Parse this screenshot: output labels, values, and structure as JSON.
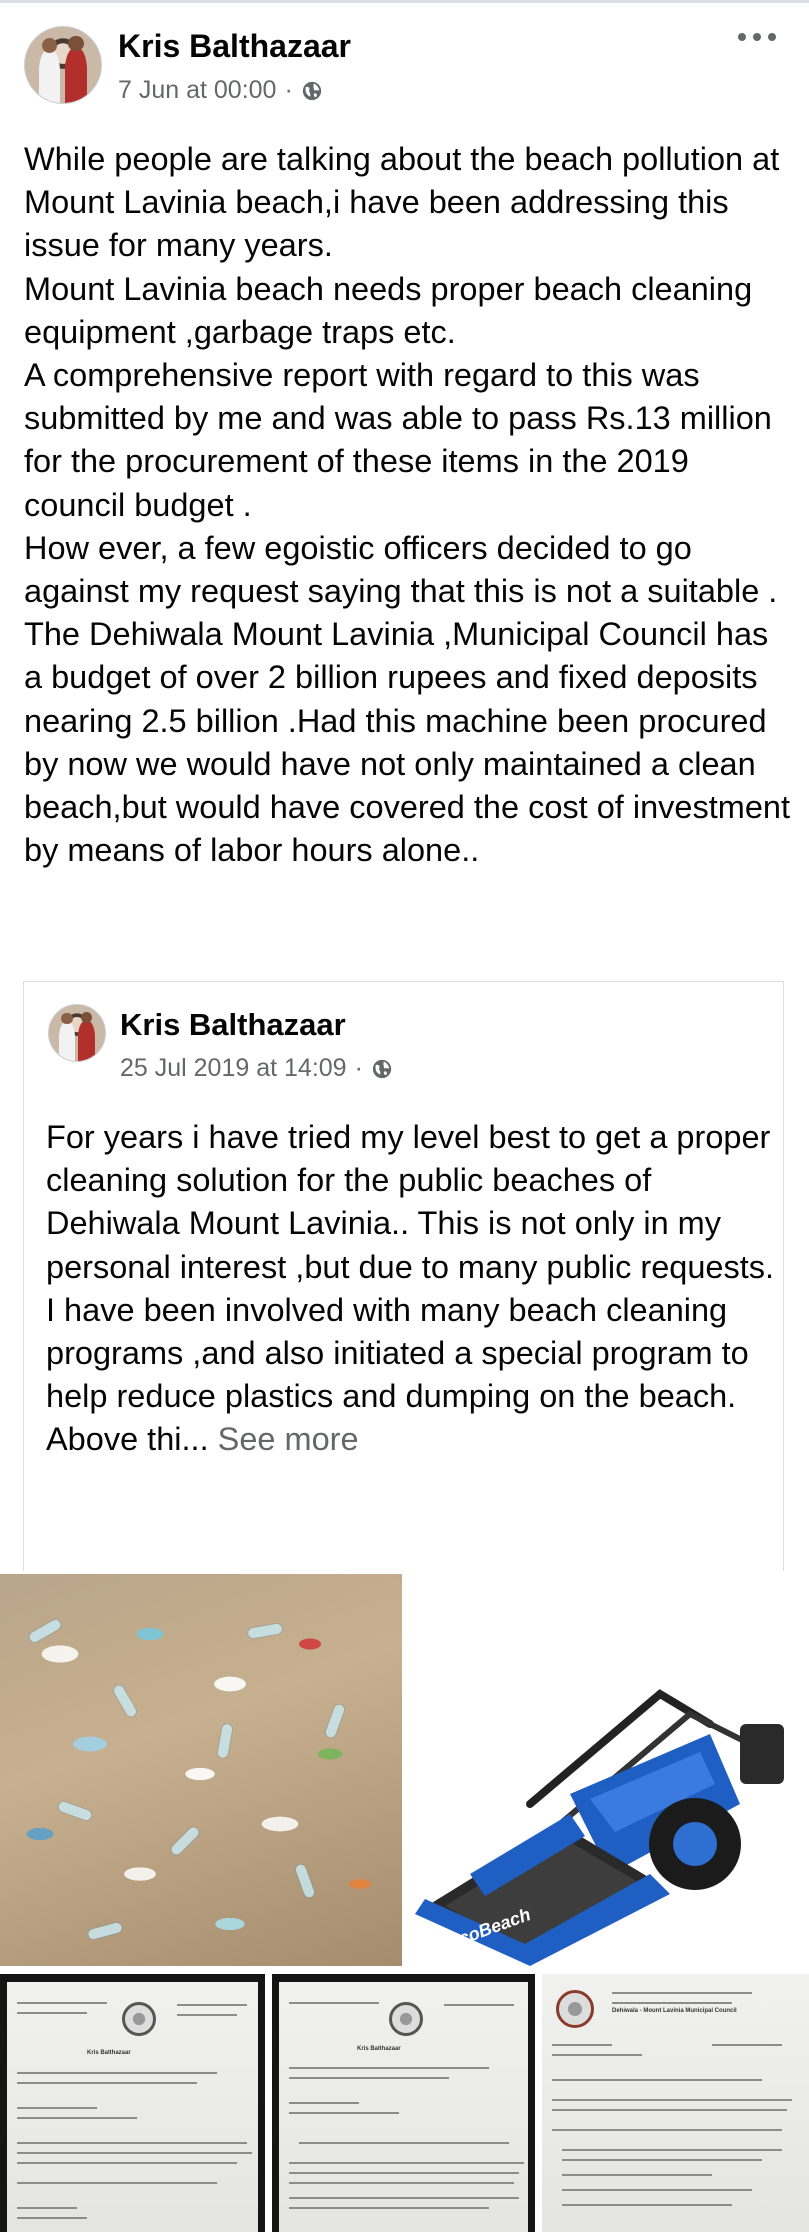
{
  "post": {
    "author": "Kris Balthazaar",
    "timestamp": "7 Jun at 00:00",
    "separator": "·",
    "privacy_icon": "globe-icon",
    "more_icon": "more-options-icon",
    "text": "While people are talking about the beach pollution at Mount Lavinia beach,i have been addressing this issue for many years.\nMount Lavinia beach needs proper beach cleaning equipment ,garbage traps etc.\nA comprehensive report with regard to this was submitted by me and was able to pass Rs.13 million for the procurement of these items in the 2019 council budget .\nHow ever, a few egoistic officers decided to go against my request saying that this is not a suitable .\nThe Dehiwala Mount Lavinia ,Municipal Council has a budget of over 2 billion rupees and fixed deposits nearing 2.5 billion .Had this machine been procured by now we would have not only maintained a clean beach,but would have covered the cost of investment by means of labor hours alone.."
  },
  "shared_post": {
    "author": "Kris Balthazaar",
    "timestamp": "25 Jul 2019 at 14:09",
    "separator": "·",
    "privacy_icon": "globe-icon",
    "text": "For years i have tried my level best to get a proper cleaning solution for the public beaches of Dehiwala Mount Lavinia.. This is not only in my personal interest ,but due to many public requests.\nI have been involved with many beach cleaning programs ,and also initiated a special program to help reduce plastics and dumping on the beach.\nAbove thi",
    "ellipsis": "... ",
    "see_more": "See more"
  },
  "photos": {
    "machine_brand": "EcoBeach",
    "doc_headers": [
      {
        "title": "Kris Balthazaar"
      },
      {
        "title": "Kris Balthazaar"
      },
      {
        "title": "Dehiwala - Mount Lavinia Municipal Council"
      }
    ]
  },
  "colors": {
    "text": "#050505",
    "secondary_text": "#65676b",
    "divider": "#dadde1",
    "machine_blue": "#1f5fc4"
  }
}
